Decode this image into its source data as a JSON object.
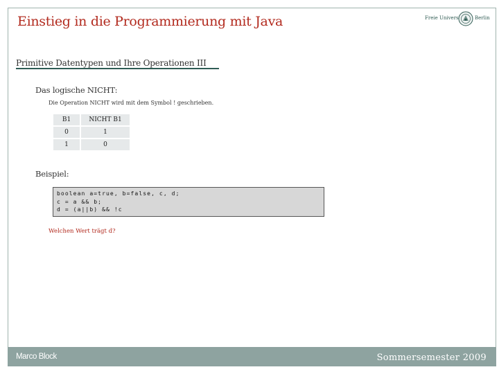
{
  "header": {
    "title": "Einstieg in die Programmierung mit Java",
    "logo": {
      "text_left": "Freie Universität",
      "text_right": "Berlin",
      "seal_icon": "university-seal-icon"
    }
  },
  "section": {
    "subtitle": "Primitive Datentypen und Ihre Operationen III",
    "heading": "Das logische NICHT:",
    "description": "Die Operation NICHT wird mit dem Symbol ! geschrieben."
  },
  "truth_table": {
    "headers": [
      "B1",
      "NICHT B1"
    ],
    "rows": [
      [
        "0",
        "1"
      ],
      [
        "1",
        "0"
      ]
    ]
  },
  "example": {
    "label": "Beispiel:",
    "code_lines": [
      "boolean a=true, b=false, c, d;",
      "c = a && b;",
      "d = (a||b) && !c"
    ],
    "question": "Welchen Wert trägt d?"
  },
  "footer": {
    "author": "Marco Block",
    "semester": "Sommersemester 2009"
  },
  "colors": {
    "accent_red": "#b22a1e",
    "frame": "#9fb3ad",
    "footer_bg": "#8ea3a0",
    "rule": "#2f5c55"
  }
}
